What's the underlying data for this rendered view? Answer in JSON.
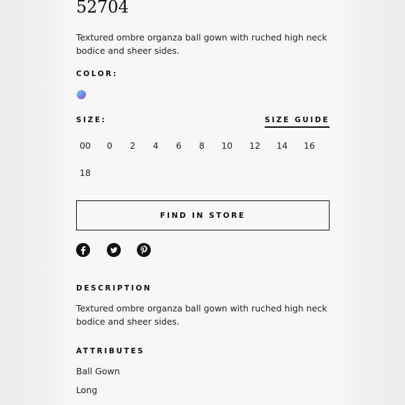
{
  "product": {
    "style_number": "52704",
    "short_description": "Textured ombre organza ball gown with ruched high neck bodice and sheer sides."
  },
  "color": {
    "label": "COLOR:",
    "swatch_name": "blue-purple-ombre-swatch",
    "swatch_colors": [
      "#6ed7e6",
      "#62a1ef",
      "#7b6fe0",
      "#9c6fd3"
    ]
  },
  "size": {
    "label": "SIZE:",
    "guide_label": "SIZE GUIDE",
    "options": [
      "00",
      "0",
      "2",
      "4",
      "6",
      "8",
      "10",
      "12",
      "14",
      "16",
      "18"
    ]
  },
  "actions": {
    "find_in_store_label": "FIND IN STORE"
  },
  "social": {
    "icons": [
      "facebook-icon",
      "twitter-icon",
      "pinterest-icon"
    ]
  },
  "description": {
    "label": "DESCRIPTION",
    "text": "Textured ombre organza ball gown with ruched high neck bodice and sheer sides."
  },
  "attributes": {
    "label": "ATTRIBUTES",
    "items": [
      "Ball Gown",
      "Long"
    ]
  }
}
